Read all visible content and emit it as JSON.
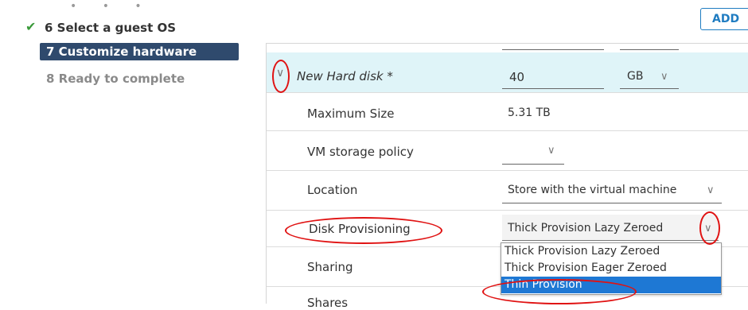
{
  "wizard": {
    "steps": [
      {
        "label": "6 Select a guest OS",
        "state": "done"
      },
      {
        "label": "7 Customize hardware",
        "state": "active"
      },
      {
        "label": "8 Ready to complete",
        "state": "pending"
      }
    ]
  },
  "toolbar": {
    "add_label": "ADD"
  },
  "hardware": {
    "disk_header": {
      "label": "New Hard disk *",
      "size_value": "40",
      "unit": "GB"
    },
    "rows": [
      {
        "label": "Maximum Size",
        "value": "5.31 TB"
      },
      {
        "label": "VM storage policy",
        "value": ""
      },
      {
        "label": "Location",
        "value": "Store with the virtual machine"
      },
      {
        "label": "Disk Provisioning",
        "value": "Thick Provision Lazy Zeroed"
      },
      {
        "label": "Sharing",
        "value": ""
      },
      {
        "label": "Shares",
        "value": ""
      }
    ]
  },
  "provisioning_dropdown": {
    "options": [
      "Thick Provision Lazy Zeroed",
      "Thick Provision Eager Zeroed",
      "Thin Provision"
    ],
    "highlighted": "Thin Provision"
  },
  "colors": {
    "active_step_bg": "#2f4a6d",
    "accent": "#1e78d4",
    "annotation": "#e01212",
    "check": "#3a9a3a"
  },
  "icons": [
    "check-icon",
    "chevron-down-icon"
  ]
}
